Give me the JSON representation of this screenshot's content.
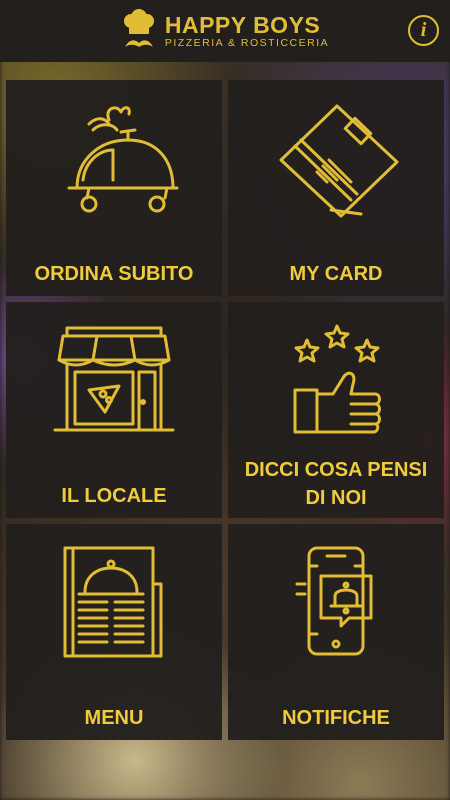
{
  "header": {
    "brand_title": "HAPPY BOYS",
    "brand_subtitle": "PIZZERIA & ROSTICCERIA",
    "info_label": "i"
  },
  "tiles": [
    {
      "label": "ORDINA SUBITO",
      "icon": "delivery-cloche-car-icon"
    },
    {
      "label": "MY CARD",
      "icon": "credit-card-icon"
    },
    {
      "label": "IL LOCALE",
      "icon": "pizzeria-storefront-icon"
    },
    {
      "label": "DICCI COSA PENSI DI NOI",
      "icon": "thumbs-up-stars-icon"
    },
    {
      "label": "MENU",
      "icon": "menu-cloche-icon"
    },
    {
      "label": "NOTIFICHE",
      "icon": "phone-bell-icon"
    }
  ],
  "colors": {
    "accent": "#e1bd35",
    "tile_bg": "#221f1d",
    "header_bg": "#221f1d"
  }
}
